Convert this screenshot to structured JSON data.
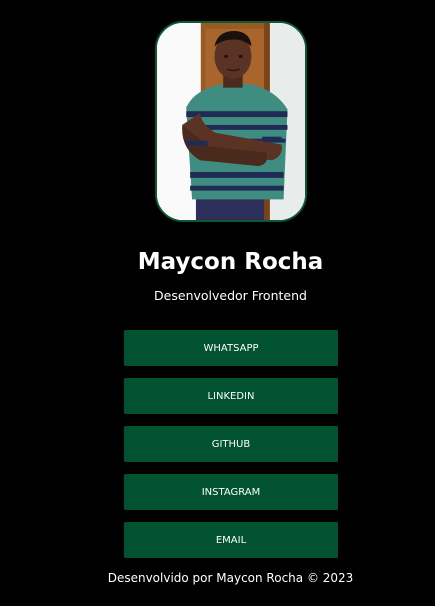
{
  "profile": {
    "name": "Maycon Rocha",
    "role": "Desenvolvedor Frontend",
    "photo_alt": "Maycon Rocha"
  },
  "links": [
    {
      "label": "WHATSAPP"
    },
    {
      "label": "LINKEDIN"
    },
    {
      "label": "GITHUB"
    },
    {
      "label": "INSTAGRAM"
    },
    {
      "label": "EMAIL"
    }
  ],
  "footer": {
    "text": "Desenvolvido por Maycon Rocha © 2023"
  },
  "colors": {
    "background": "#000000",
    "button": "#005230",
    "photo_border": "#0b5a34",
    "text": "#ffffff"
  }
}
